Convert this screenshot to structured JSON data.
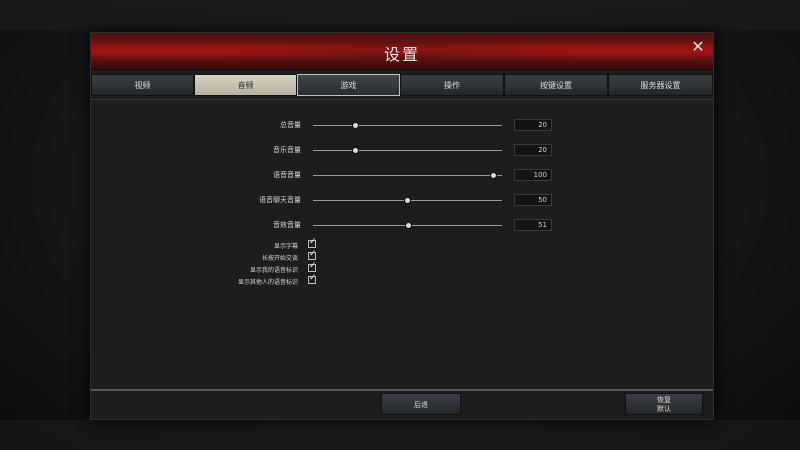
{
  "window": {
    "title": "设置",
    "close_icon": "close-icon"
  },
  "tabs": [
    {
      "label": "视频"
    },
    {
      "label": "音频"
    },
    {
      "label": "游戏"
    },
    {
      "label": "操作"
    },
    {
      "label": "按键设置"
    },
    {
      "label": "服务器设置"
    }
  ],
  "active_tab": "音频",
  "sliders": [
    {
      "label": "总音量",
      "value": "20",
      "fraction": 0.23
    },
    {
      "label": "音乐音量",
      "value": "20",
      "fraction": 0.23
    },
    {
      "label": "语音音量",
      "value": "100",
      "fraction": 0.96
    },
    {
      "label": "语音聊天音量",
      "value": "50",
      "fraction": 0.5
    },
    {
      "label": "音效音量",
      "value": "51",
      "fraction": 0.51
    }
  ],
  "checkboxes": [
    {
      "label": "显示字幕",
      "checked": true
    },
    {
      "label": "长按开始交谈",
      "checked": true
    },
    {
      "label": "显示我的语音标识",
      "checked": true
    },
    {
      "label": "显示其他人的语音标识",
      "checked": true
    }
  ],
  "footer": {
    "back_label": "后退",
    "reset_label": "恢复\n默认"
  },
  "colors": {
    "title_bar_red": "#7a1414",
    "active_tab_bg": "#d9d3c4"
  }
}
